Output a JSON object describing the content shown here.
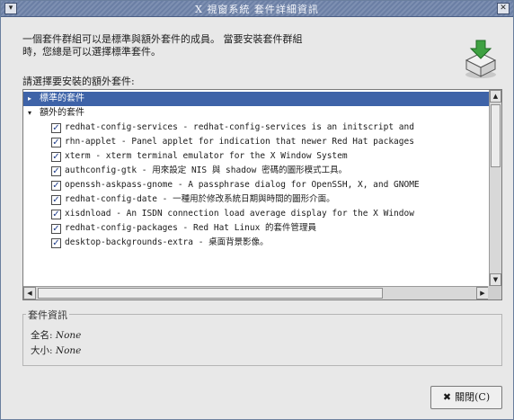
{
  "window": {
    "title": "X 視窗系統 套件詳細資訊",
    "menu_icon": "chevron-down-icon",
    "close_icon": "close-icon"
  },
  "intro": {
    "line1": "一個套件群組可以是標準與額外套件的成員。 當要安裝套件群組",
    "line2": "時，您總是可以選擇標準套件。"
  },
  "select_label": "請選擇要安裝的額外套件:",
  "list": {
    "groups": [
      {
        "label": "標準的套件",
        "expander": "▸"
      },
      {
        "label": "額外的套件",
        "expander": "▾"
      }
    ],
    "packages": [
      {
        "text": "redhat-config-services - redhat-config-services is an initscript and",
        "checked": true
      },
      {
        "text": "rhn-applet - Panel applet for indication that newer Red Hat packages",
        "checked": true
      },
      {
        "text": "xterm - xterm terminal emulator for the X Window System",
        "checked": true
      },
      {
        "text": "authconfig-gtk - 用來設定 NIS 與 shadow 密碼的圖形模式工具。",
        "checked": true
      },
      {
        "text": "openssh-askpass-gnome - A passphrase dialog for OpenSSH, X, and GNOME",
        "checked": true
      },
      {
        "text": "redhat-config-date - 一種用於修改系統日期與時間的圖形介面。",
        "checked": true
      },
      {
        "text": "xisdnload - An ISDN connection load average display for the X Window",
        "checked": true
      },
      {
        "text": "redhat-config-packages - Red Hat Linux 的套件管理員",
        "checked": true
      },
      {
        "text": "desktop-backgrounds-extra - 桌面背景影像。",
        "checked": true
      }
    ]
  },
  "info": {
    "title": "套件資訊",
    "fullname_label": "全名:",
    "fullname_value": "None",
    "size_label": "大小:",
    "size_value": "None"
  },
  "buttons": {
    "close_label": "關閉(C)"
  },
  "colors": {
    "titlebar": "#6b7fa5",
    "selection": "#3e63a8",
    "window_bg": "#e8e8e8"
  }
}
